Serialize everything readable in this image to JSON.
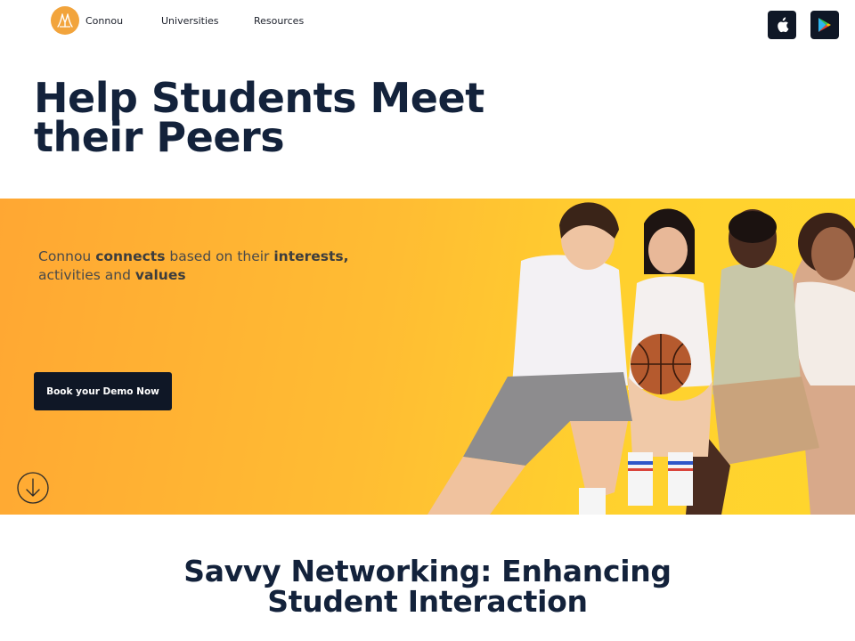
{
  "nav": {
    "brand": "Connou",
    "links": [
      "Universities",
      "Resources"
    ],
    "logo_icon": "connou-logo-icon",
    "store_icons": [
      "apple-icon",
      "google-play-icon"
    ]
  },
  "hero": {
    "title": "Help Students Meet their Peers"
  },
  "banner": {
    "text_parts": [
      {
        "text": "Connou ",
        "bold": false
      },
      {
        "text": "connects",
        "bold": true
      },
      {
        "text": " based on their ",
        "bold": false
      },
      {
        "text": "interests,",
        "bold": true
      },
      {
        "text": " activities and ",
        "bold": false
      },
      {
        "text": "values",
        "bold": true
      }
    ],
    "cta_label": "Book your Demo Now",
    "scroll_icon": "arrow-down-circle-icon"
  },
  "section": {
    "title": "Savvy Networking: Enhancing Student Interaction"
  },
  "colors": {
    "navy": "#13223b",
    "button_dark": "#0f1726",
    "banner_orange": "#ffa733",
    "banner_yellow": "#ffd62d",
    "logo_orange": "#f2a43c"
  }
}
